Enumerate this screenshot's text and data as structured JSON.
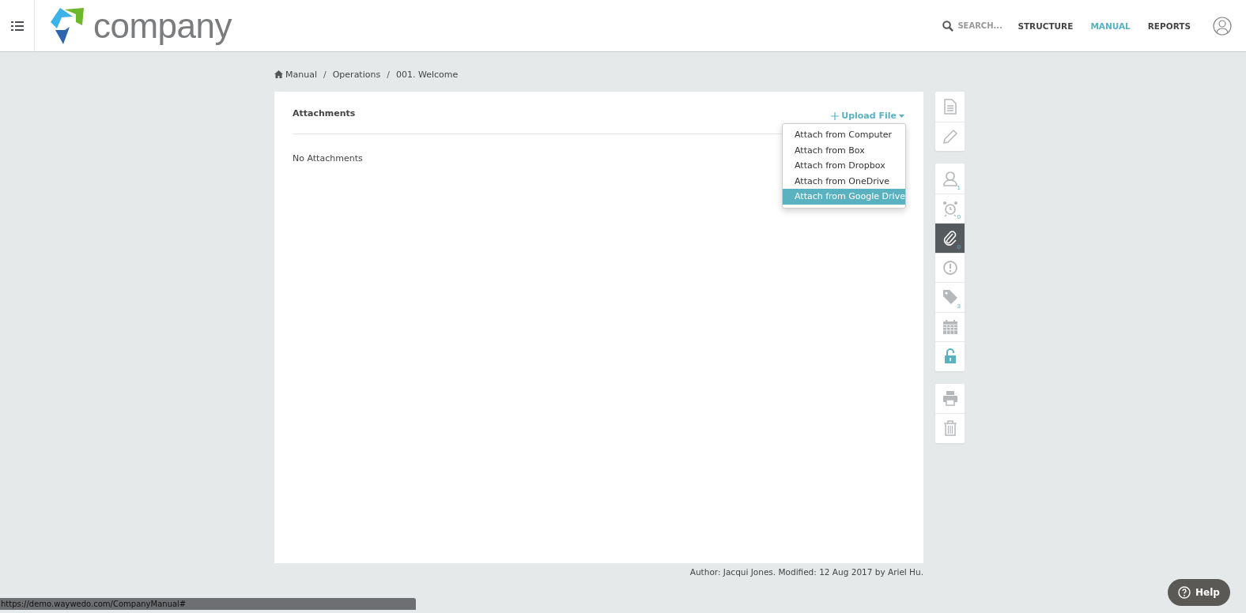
{
  "header": {
    "logo_text": "company",
    "search": {
      "placeholder": "SEARCH..."
    },
    "nav": [
      {
        "label": "STRUCTURE",
        "selected": false
      },
      {
        "label": "MANUAL",
        "selected": true
      },
      {
        "label": "REPORTS",
        "selected": false
      }
    ]
  },
  "breadcrumb": [
    "Manual",
    "Operations",
    "001. Welcome"
  ],
  "breadcrumb_separator": "/",
  "panel": {
    "title": "Attachments",
    "upload_button": "Upload File",
    "empty_text": "No Attachments",
    "upload_menu": [
      {
        "label": "Attach from Computer",
        "selected": false
      },
      {
        "label": "Attach from Box",
        "selected": false
      },
      {
        "label": "Attach from Dropbox",
        "selected": false
      },
      {
        "label": "Attach from OneDrive",
        "selected": false
      },
      {
        "label": "Attach from Google Drive",
        "selected": true
      }
    ]
  },
  "side_toolbar": [
    [
      {
        "kind": "document",
        "selected": false,
        "on": false
      },
      {
        "kind": "edit",
        "selected": false,
        "on": false
      }
    ],
    [
      {
        "kind": "user",
        "badge": "1",
        "selected": false,
        "on": false
      },
      {
        "kind": "alarm",
        "badge": "0",
        "selected": false,
        "on": false
      },
      {
        "kind": "attachment",
        "badge": "0",
        "selected": true,
        "on": false
      },
      {
        "kind": "alert",
        "selected": false,
        "on": false
      },
      {
        "kind": "tag",
        "badge": "3",
        "selected": false,
        "on": false
      },
      {
        "kind": "calendar",
        "selected": false,
        "on": false
      },
      {
        "kind": "lock",
        "selected": false,
        "on": true
      }
    ],
    [
      {
        "kind": "print",
        "selected": false,
        "on": false
      },
      {
        "kind": "delete",
        "selected": false,
        "on": false
      }
    ]
  ],
  "footer": "Author: Jacqui Jones. Modified: 12 Aug 2017 by Ariel Hu.",
  "help_button": "Help",
  "status_bar": "https://demo.waywedo.com/CompanyManual#"
}
